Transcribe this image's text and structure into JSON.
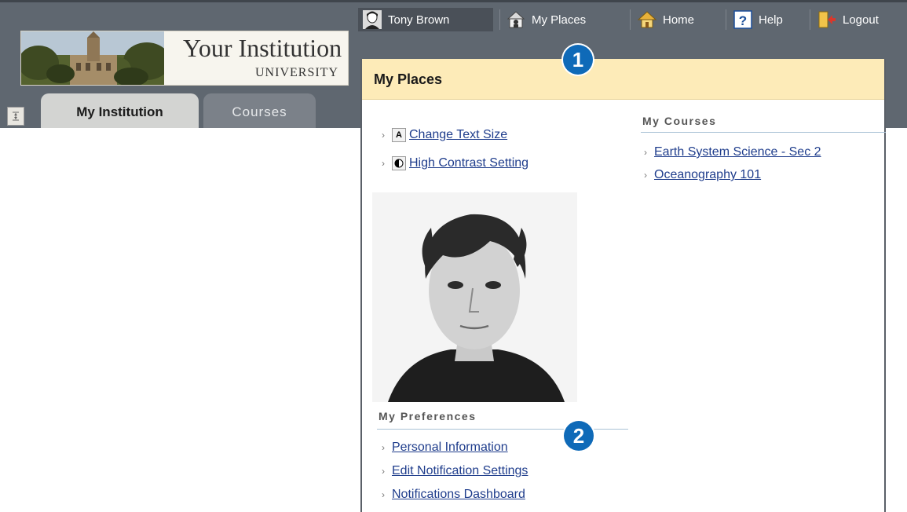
{
  "institution": {
    "name_line1": "Your Institution",
    "name_line2": "UNIVERSITY"
  },
  "tabs": [
    {
      "label": "My Institution",
      "active": true
    },
    {
      "label": "Courses",
      "active": false
    }
  ],
  "topnav": {
    "user": "Tony Brown",
    "my_places": "My Places",
    "home": "Home",
    "help": "Help",
    "logout": "Logout"
  },
  "panel": {
    "title": "My Places",
    "callouts": [
      "1",
      "2"
    ],
    "accessibility_links": [
      "Change Text Size",
      "High Contrast Setting"
    ],
    "my_courses": {
      "title": "My Courses",
      "items": [
        "Earth System Science - Sec 2",
        "Oceanography 101"
      ]
    },
    "my_preferences": {
      "title": "My Preferences",
      "items": [
        "Personal Information",
        "Edit Notification Settings",
        "Notifications Dashboard"
      ]
    }
  },
  "colors": {
    "header": "#5f6770",
    "panel_header": "#fdebb8",
    "link": "#1f3d8c",
    "callout": "#0f6ab8"
  },
  "icons": {
    "user": "user-avatar-icon",
    "my_places": "my-places-icon",
    "home": "home-icon",
    "help": "help-icon",
    "logout": "logout-icon",
    "text_size": "text-size-icon",
    "contrast": "contrast-icon"
  }
}
